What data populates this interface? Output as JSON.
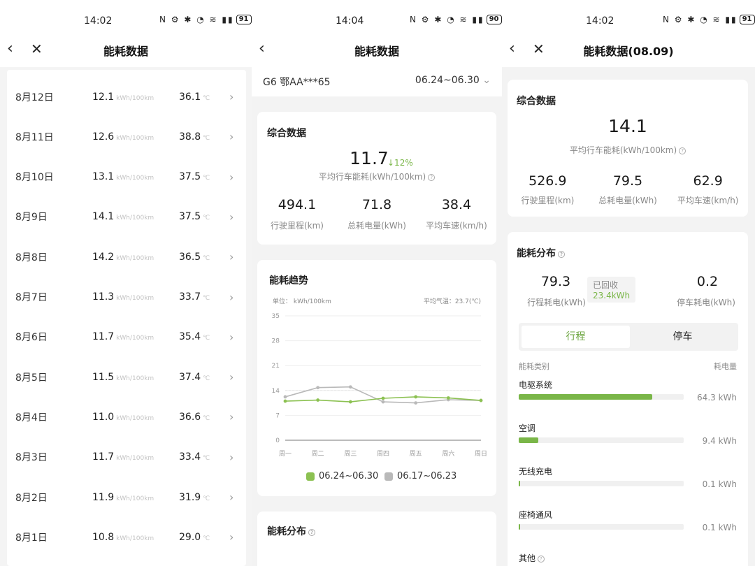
{
  "panels": [
    {
      "time": "14:02",
      "battery": "91"
    },
    {
      "time": "14:04",
      "battery": "90"
    },
    {
      "time": "14:02",
      "battery": "91"
    }
  ],
  "status_icons": "N ⚙ ✱ ◔ ≋ ▮▮",
  "icons": {
    "back": "back-icon",
    "close": "close-icon",
    "chevron": "chevron-right-icon"
  },
  "p1": {
    "title": "能耗数据",
    "unit": "kWh/100km",
    "temp_unit": "℃",
    "rows": [
      {
        "date": "8月12日",
        "value": "12.1",
        "temp": "36.1"
      },
      {
        "date": "8月11日",
        "value": "12.6",
        "temp": "38.8"
      },
      {
        "date": "8月10日",
        "value": "13.1",
        "temp": "37.5"
      },
      {
        "date": "8月9日",
        "value": "14.1",
        "temp": "37.5"
      },
      {
        "date": "8月8日",
        "value": "14.2",
        "temp": "36.5"
      },
      {
        "date": "8月7日",
        "value": "11.3",
        "temp": "33.7"
      },
      {
        "date": "8月6日",
        "value": "11.7",
        "temp": "35.4"
      },
      {
        "date": "8月5日",
        "value": "11.5",
        "temp": "37.4"
      },
      {
        "date": "8月4日",
        "value": "11.0",
        "temp": "36.6"
      },
      {
        "date": "8月3日",
        "value": "11.7",
        "temp": "33.4"
      },
      {
        "date": "8月2日",
        "value": "11.9",
        "temp": "31.9"
      },
      {
        "date": "8月1日",
        "value": "10.8",
        "temp": "29.0"
      }
    ]
  },
  "p2": {
    "title": "能耗数据",
    "car": "G6 鄂AA***65",
    "range": "06.24~06.30",
    "summary_title": "综合数据",
    "avg_value": "11.7",
    "change": "↓12%",
    "avg_caption": "平均行车能耗(kWh/100km)",
    "stats": [
      {
        "value": "494.1",
        "label": "行驶里程(km)"
      },
      {
        "value": "71.8",
        "label": "总耗电量(kWh)"
      },
      {
        "value": "38.4",
        "label": "平均车速(km/h)"
      }
    ],
    "trend_title": "能耗趋势",
    "unit_label": "单位： kWh/100km",
    "avg_temp": "平均气温：23.7(℃)",
    "dist_title": "能耗分布"
  },
  "chart_data": {
    "type": "line",
    "categories": [
      "周一",
      "周二",
      "周三",
      "周四",
      "周五",
      "周六",
      "周日"
    ],
    "series": [
      {
        "name": "06.24~06.30",
        "color": "#8cc152",
        "values": [
          11.0,
          11.3,
          10.8,
          11.8,
          12.2,
          11.9,
          11.2
        ]
      },
      {
        "name": "06.17~06.23",
        "color": "#b9b9b9",
        "values": [
          12.2,
          14.8,
          15.0,
          10.8,
          10.5,
          11.4,
          11.2
        ]
      }
    ],
    "yticks": [
      "35",
      "28",
      "21",
      "14",
      "7",
      "0"
    ],
    "ylim": [
      0,
      35
    ],
    "reference_line": 14,
    "grid": true,
    "legend_position": "bottom-center"
  },
  "p3": {
    "title": "能耗数据(08.09)",
    "summary_title": "综合数据",
    "avg_value": "14.1",
    "avg_caption": "平均行车能耗(kWh/100km)",
    "stats": [
      {
        "value": "526.9",
        "label": "行驶里程(km)"
      },
      {
        "value": "79.5",
        "label": "总耗电量(kWh)"
      },
      {
        "value": "62.9",
        "label": "平均车速(km/h)"
      }
    ],
    "dist_title": "能耗分布",
    "drive_value": "79.3",
    "drive_label": "行程耗电(kWh)",
    "recv_label": "已回收",
    "recv_value": "23.4kWh",
    "park_value": "0.2",
    "park_label": "停车耗电(kWh)",
    "tab_trip": "行程",
    "tab_park": "停车",
    "col_category": "能耗类别",
    "col_usage": "耗电量",
    "items": [
      {
        "name": "电驱系统",
        "value": "64.3 kWh",
        "fraction": 0.81
      },
      {
        "name": "空调",
        "value": "9.4 kWh",
        "fraction": 0.12
      },
      {
        "name": "无线充电",
        "value": "0.1 kWh",
        "fraction": 0.002
      },
      {
        "name": "座椅通风",
        "value": "0.1 kWh",
        "fraction": 0.002
      }
    ],
    "other_label": "其他"
  }
}
